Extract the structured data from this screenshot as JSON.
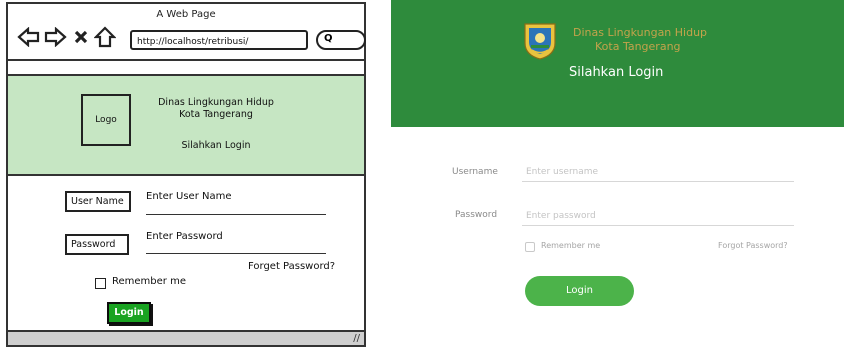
{
  "wireframe": {
    "window_title": "A Web Page",
    "nav_icons": [
      "back-arrow-icon",
      "forward-arrow-icon",
      "close-x-icon",
      "home-icon"
    ],
    "url": "http://localhost/retribusi/",
    "search_icon_glyph": "Q",
    "header": {
      "logo_text": "Logo",
      "org_line1": "Dinas Lingkungan Hidup",
      "org_line2": "Kota Tangerang",
      "subtitle": "Silahkan Login",
      "background": "#c6e6c3"
    },
    "form": {
      "username_label": "User Name",
      "username_placeholder": "Enter User Name",
      "password_label": "Password",
      "password_placeholder": "Enter Password",
      "forget_link": "Forget Password?",
      "remember_label": "Remember me",
      "login_button": "Login",
      "login_color": "#19a321"
    }
  },
  "rendered": {
    "header": {
      "background": "#2e8b3c",
      "org_line1": "Dinas Lingkungan Hidup",
      "org_line2": "Kota Tangerang",
      "subtitle": "Silahkan Login",
      "logo_icon": "tangerang-emblem-icon"
    },
    "form": {
      "username_label": "Username",
      "username_placeholder": "Enter username",
      "password_label": "Password",
      "password_placeholder": "Enter password",
      "remember_label": "Remember me",
      "forgot_link": "Forgot Password?",
      "login_button": "Login",
      "login_color": "#4cb34a"
    }
  }
}
